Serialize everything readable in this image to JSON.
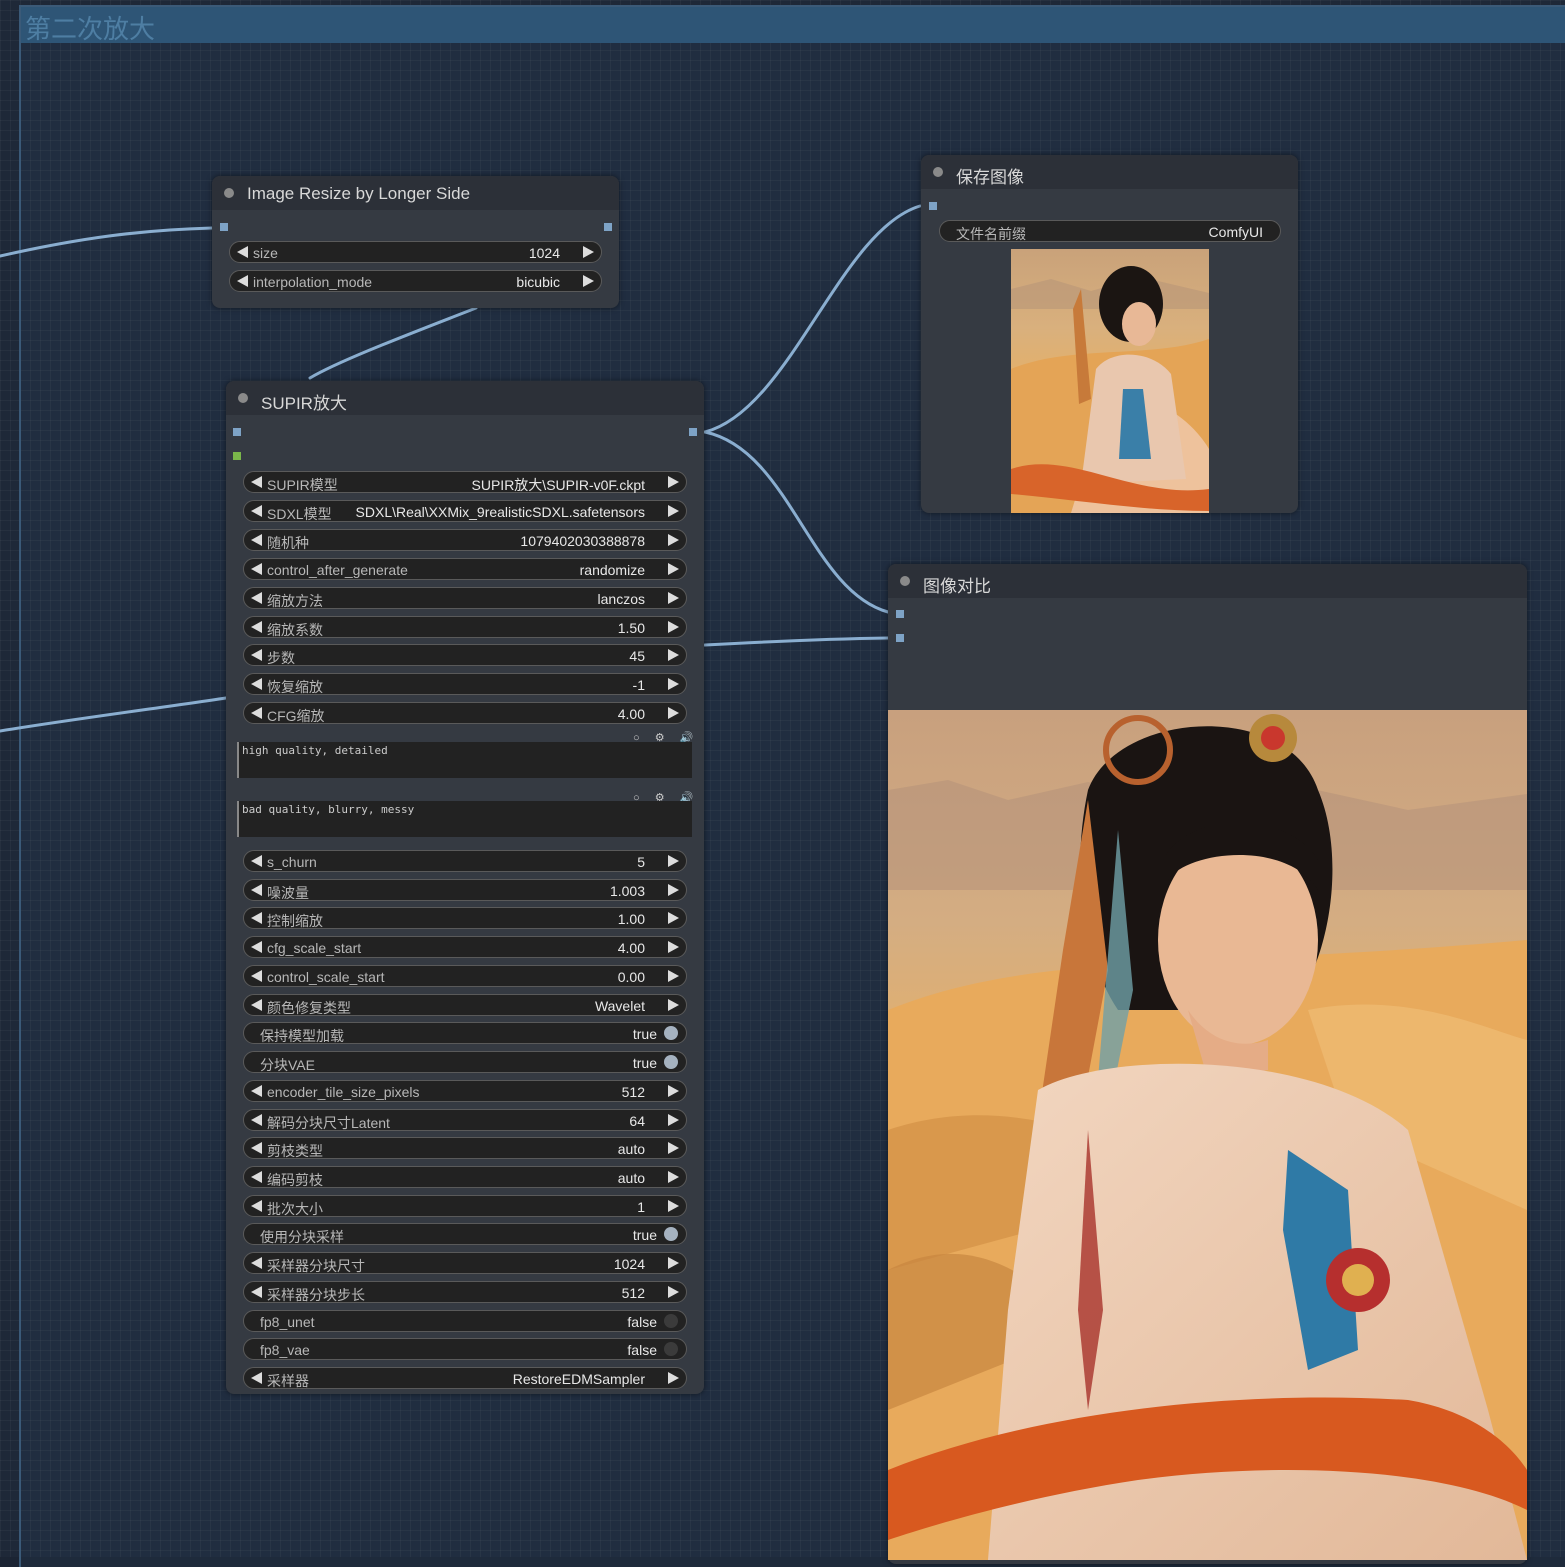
{
  "group": {
    "title": "第二次放大"
  },
  "nodes": {
    "resize": {
      "title": "Image Resize by Longer Side",
      "widgets": [
        {
          "label": "size",
          "value": "1024"
        },
        {
          "label": "interpolation_mode",
          "value": "bicubic"
        }
      ]
    },
    "supir": {
      "title": "SUPIR放大",
      "widgets": [
        {
          "label": "SUPIR模型",
          "value": "SUPIR放大\\SUPIR-v0F.ckpt"
        },
        {
          "label": "SDXL模型",
          "value": "SDXL\\Real\\XXMix_9realisticSDXL.safetensors"
        },
        {
          "label": "随机种",
          "value": "1079402030388878"
        },
        {
          "label": "control_after_generate",
          "value": "randomize"
        },
        {
          "label": "缩放方法",
          "value": "lanczos"
        },
        {
          "label": "缩放系数",
          "value": "1.50"
        },
        {
          "label": "步数",
          "value": "45"
        },
        {
          "label": "恢复缩放",
          "value": "-1"
        },
        {
          "label": "CFG缩放",
          "value": "4.00"
        }
      ],
      "positive_prompt": "high quality, detailed",
      "negative_prompt": "bad quality, blurry, messy",
      "widgets2": [
        {
          "label": "s_churn",
          "value": "5"
        },
        {
          "label": "噪波量",
          "value": "1.003"
        },
        {
          "label": "控制缩放",
          "value": "1.00"
        },
        {
          "label": "cfg_scale_start",
          "value": "4.00"
        },
        {
          "label": "control_scale_start",
          "value": "0.00"
        },
        {
          "label": "颜色修复类型",
          "value": "Wavelet"
        },
        {
          "label": "保持模型加载",
          "value": "true"
        },
        {
          "label": "分块VAE",
          "value": "true"
        },
        {
          "label": "encoder_tile_size_pixels",
          "value": "512"
        },
        {
          "label": "解码分块尺寸Latent",
          "value": "64"
        },
        {
          "label": "剪枝类型",
          "value": "auto"
        },
        {
          "label": "编码剪枝",
          "value": "auto"
        },
        {
          "label": "批次大小",
          "value": "1"
        },
        {
          "label": "使用分块采样",
          "value": "true"
        },
        {
          "label": "采样器分块尺寸",
          "value": "1024"
        },
        {
          "label": "采样器分块步长",
          "value": "512"
        },
        {
          "label": "fp8_unet",
          "value": "false"
        },
        {
          "label": "fp8_vae",
          "value": "false"
        },
        {
          "label": "采样器",
          "value": "RestoreEDMSampler"
        }
      ]
    },
    "save": {
      "title": "保存图像",
      "prefix_label": "文件名前缀",
      "prefix_value": "ComfyUI"
    },
    "compare": {
      "title": "图像对比"
    }
  },
  "icons": {
    "textarea_icons": "○ ⚙ 🔊",
    "arrow_left": "triangle-left-icon",
    "arrow_right": "triangle-right-icon"
  },
  "colors": {
    "link": "#8aaed0",
    "slot": "#7ea3c6",
    "group_header": "#2e5576"
  }
}
